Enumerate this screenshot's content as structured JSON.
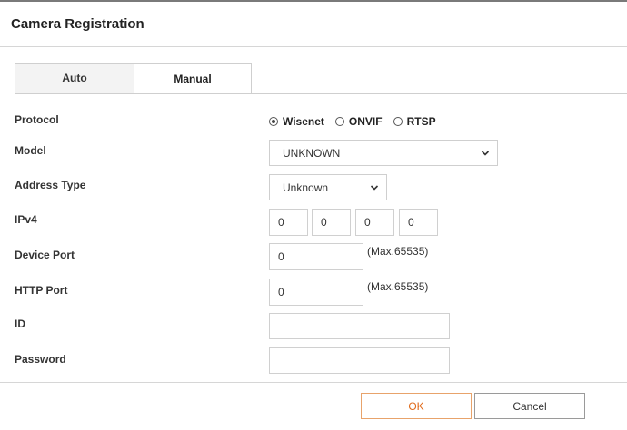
{
  "dialog": {
    "title": "Camera Registration"
  },
  "tabs": [
    {
      "label": "Auto"
    },
    {
      "label": "Manual"
    }
  ],
  "form": {
    "protocol": {
      "label": "Protocol",
      "options": [
        {
          "label": "Wisenet",
          "selected": true
        },
        {
          "label": "ONVIF",
          "selected": false
        },
        {
          "label": "RTSP",
          "selected": false
        }
      ]
    },
    "model": {
      "label": "Model",
      "value": "UNKNOWN"
    },
    "address_type": {
      "label": "Address Type",
      "value": "Unknown"
    },
    "ipv4": {
      "label": "IPv4",
      "octets": [
        "0",
        "0",
        "0",
        "0"
      ]
    },
    "device_port": {
      "label": "Device Port",
      "value": "0",
      "note": "(Max.65535)"
    },
    "http_port": {
      "label": "HTTP Port",
      "value": "0",
      "note": "(Max.65535)"
    },
    "id": {
      "label": "ID",
      "value": ""
    },
    "password": {
      "label": "Password",
      "value": ""
    }
  },
  "buttons": {
    "ok": "OK",
    "cancel": "Cancel"
  },
  "colors": {
    "ok_accent": "#e06a1a",
    "border": "#cfcfcf"
  }
}
